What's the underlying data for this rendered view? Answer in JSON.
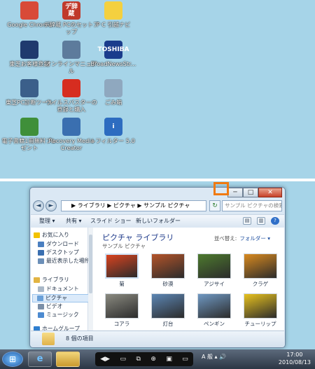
{
  "desktop": {
    "icons": [
      {
        "label": "Google Chrome",
        "icon": "chrome-icon",
        "color": "#d84a38"
      },
      {
        "label": "デ辞蔵 PCのセットアップ",
        "icon": "dejizo-setup-icon",
        "color": "#c0392b",
        "glyph": "デ辞蔵"
      },
      {
        "label": "P C 引越ナビ",
        "icon": "pc-hikkoshi-navi-icon",
        "color": "#f4d03f"
      },
      {
        "label": "東芝お客様登録",
        "icon": "toshiba-registration-icon",
        "color": "#1f3a6e"
      },
      {
        "label": "オンラインマニュアル",
        "icon": "online-manual-icon",
        "color": "#5d7b9c"
      },
      {
        "label": "BroadNewsStr...",
        "icon": "broadnews-icon",
        "color": "#1a3c8c",
        "glyph": "TOSHIBA"
      },
      {
        "label": "東芝PC診断ツール",
        "icon": "pc-diagnostic-icon",
        "color": "#3b5f8a"
      },
      {
        "label": "ウイルスバスターの登録と購入",
        "icon": "virusbuster-icon",
        "color": "#d62d20"
      },
      {
        "label": "ごみ箱",
        "icon": "recycle-bin-icon",
        "color": "#8fa8bf"
      },
      {
        "label": "電子書籍1冊無料プレゼント",
        "icon": "ebook-tree-icon",
        "color": "#3f8f3a"
      },
      {
        "label": "Recovery Media Creator",
        "icon": "recovery-media-icon",
        "color": "#3a6fb0"
      },
      {
        "label": "i-フィルター 5.0",
        "icon": "i-filter-icon",
        "color": "#2d6cc0",
        "glyph": "i"
      }
    ]
  },
  "window": {
    "controls": {
      "minimize": "─",
      "maximize": "□",
      "close": "✕"
    },
    "back_glyph": "◄",
    "forward_glyph": "►",
    "address": "▶ ライブラリ ▶ ピクチャ ▶ サンプル ピクチャ",
    "search_placeholder": "サンプル ピクチャの検索",
    "toolbar": {
      "organize": "整理 ▾",
      "share": "共有 ▾",
      "slideshow": "スライド ショー",
      "new_folder": "新しいフォルダー",
      "help": "?"
    },
    "nav": [
      {
        "label": "お気に入り",
        "color": "#f2c200"
      },
      {
        "label": "ダウンロード",
        "color": "#4a7fc0"
      },
      {
        "label": "デスクトップ",
        "color": "#3a6fb0"
      },
      {
        "label": "最近表示した場所",
        "color": "#6b8fb8"
      },
      {
        "label": "ライブラリ",
        "color": "#e2b443"
      },
      {
        "label": "ドキュメント",
        "color": "#a9b8c8"
      },
      {
        "label": "ピクチャ",
        "color": "#6aa0d8"
      },
      {
        "label": "ビデオ",
        "color": "#7b8fa8"
      },
      {
        "label": "ミュージック",
        "color": "#4c8ad0"
      },
      {
        "label": "ホームグループ",
        "color": "#2f7fd0"
      }
    ],
    "library_title": "ピクチャ ライブラリ",
    "library_subtitle": "サンプル ピクチャ",
    "arrange_label": "並べ替え:",
    "arrange_value": "フォルダー ▾",
    "thumbnails": [
      {
        "label": "菊",
        "color": "#d9431f",
        "selected": true
      },
      {
        "label": "砂漠",
        "color": "#b4542a"
      },
      {
        "label": "アジサイ",
        "color": "#4d7a2e"
      },
      {
        "label": "クラゲ",
        "color": "#d98a1f"
      },
      {
        "label": "コアラ",
        "color": "#8a8a80"
      },
      {
        "label": "灯台",
        "color": "#5c86b4"
      },
      {
        "label": "ペンギン",
        "color": "#6f98c2"
      },
      {
        "label": "チューリップ",
        "color": "#e8c21e"
      }
    ],
    "status": "8 個の項目"
  },
  "taskbar": {
    "start_glyph": "⊞",
    "ie_glyph": "e",
    "explorer_glyph": "📁",
    "media_controls": [
      "◀▶",
      "▭",
      "⧉",
      "⊕",
      "▣",
      "▭"
    ],
    "tray_text": "A 般 ▴ 🔊",
    "time": "17:00",
    "date": "2010/08/13"
  }
}
